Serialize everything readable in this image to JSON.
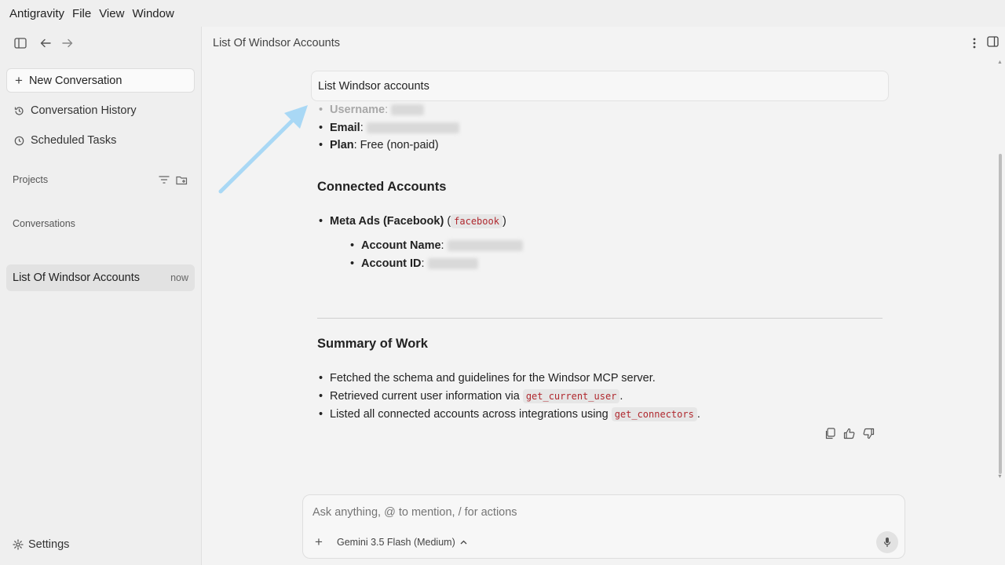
{
  "menubar": {
    "items": [
      "Antigravity",
      "File",
      "View",
      "Window"
    ]
  },
  "sidebar": {
    "new_conversation": "New Conversation",
    "history": "Conversation History",
    "scheduled": "Scheduled Tasks",
    "projects_label": "Projects",
    "conversations_label": "Conversations",
    "conversation": {
      "title": "List Of Windsor Accounts",
      "time": "now"
    },
    "settings": "Settings"
  },
  "main": {
    "title": "List Of Windsor Accounts",
    "user_message": "List Windsor accounts",
    "user_info": {
      "username_label": "Username",
      "email_label": "Email",
      "plan_label": "Plan",
      "plan_value": ": Free (non-paid)"
    },
    "connected_heading": "Connected Accounts",
    "connector": {
      "name": "Meta Ads (Facebook)",
      "code": "facebook"
    },
    "account_name_label": "Account Name",
    "account_id_label": "Account ID",
    "summary_heading": "Summary of Work",
    "summary": {
      "item1": "Fetched the schema and guidelines for the Windsor MCP server.",
      "item2_text": "Retrieved current user information via ",
      "item2_code": "get_current_user",
      "item3_text": "Listed all connected accounts across integrations using ",
      "item3_code": "get_connectors"
    }
  },
  "composer": {
    "placeholder": "Ask anything, @ to mention, / for actions",
    "model": "Gemini 3.5 Flash (Medium)"
  },
  "colors": {
    "code_text": "#b0282e",
    "arrow": "#a9d8f5"
  }
}
